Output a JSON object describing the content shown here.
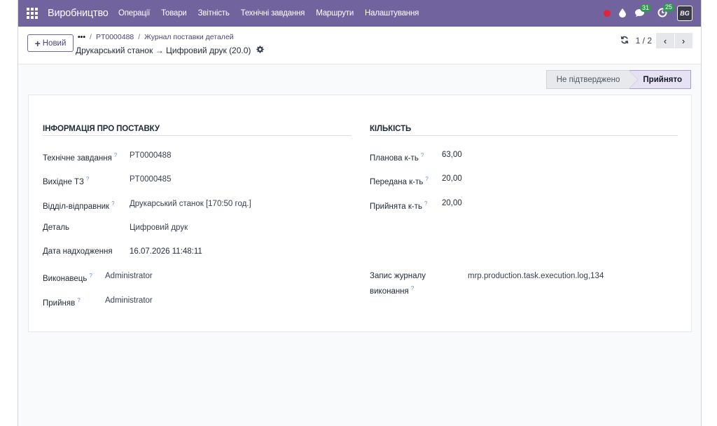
{
  "navbar": {
    "brand": "Виробництво",
    "menu": [
      "Операції",
      "Товари",
      "Звітність",
      "Технічні завдання",
      "Маршрути",
      "Налаштування"
    ],
    "messages_count": "31",
    "activities_count": "25",
    "avatar_text": "BG"
  },
  "control": {
    "new_button": "Новий",
    "breadcrumb_more": "•••",
    "breadcrumb_sep": "/",
    "breadcrumb_1": "PT0000488",
    "breadcrumb_2": "Журнал поставки деталей",
    "record_title": "Друкарський станок → Цифровий друк (20.0)",
    "pager_value": "1 / 2"
  },
  "status": {
    "stage_1": "Не підтверджено",
    "stage_2": "Прийнято",
    "active_stage": "Прийнято"
  },
  "form": {
    "left_title": "ІНФОРМАЦІЯ ПРО ПОСТАВКУ",
    "right_title": "КІЛЬКІСТЬ",
    "help_mark": "?",
    "fields_left": [
      {
        "label": "Технічне завдання",
        "value": "PT0000488"
      },
      {
        "label": "Вихідне ТЗ",
        "value": "PT0000485"
      },
      {
        "label": "Відділ-відправник",
        "value": "Друкарський станок [170:50 год.]"
      },
      {
        "label": "Деталь",
        "value": "Цифровий друк"
      },
      {
        "label": "Дата надходження",
        "value": "16.07.2026 11:48:11"
      },
      {
        "label": "Виконавець",
        "value": "Administrator"
      },
      {
        "label": "Прийняв",
        "value": "Administrator"
      }
    ],
    "fields_right": [
      {
        "label": "Планова к-ть",
        "value": "63,00"
      },
      {
        "label": "Передана к-ть",
        "value": "20,00"
      },
      {
        "label": "Прийнята к-ть",
        "value": "20,00"
      },
      {
        "label": "Запис журналу виконання",
        "label_line1": "Запис журналу",
        "label_line2": "виконання",
        "value": "mrp.production.task.execution.log,134"
      }
    ]
  },
  "colors": {
    "navbar": "#71639e",
    "status_active": "#e6e1f3",
    "badge": "#2f9a52",
    "alert": "#e0243b"
  },
  "icons": [
    "apps-icon",
    "bug-icon",
    "drop-icon",
    "chat-icon",
    "clock-icon",
    "plus-icon",
    "gear-icon",
    "refresh-icon",
    "chevron-left-icon",
    "chevron-right-icon"
  ]
}
